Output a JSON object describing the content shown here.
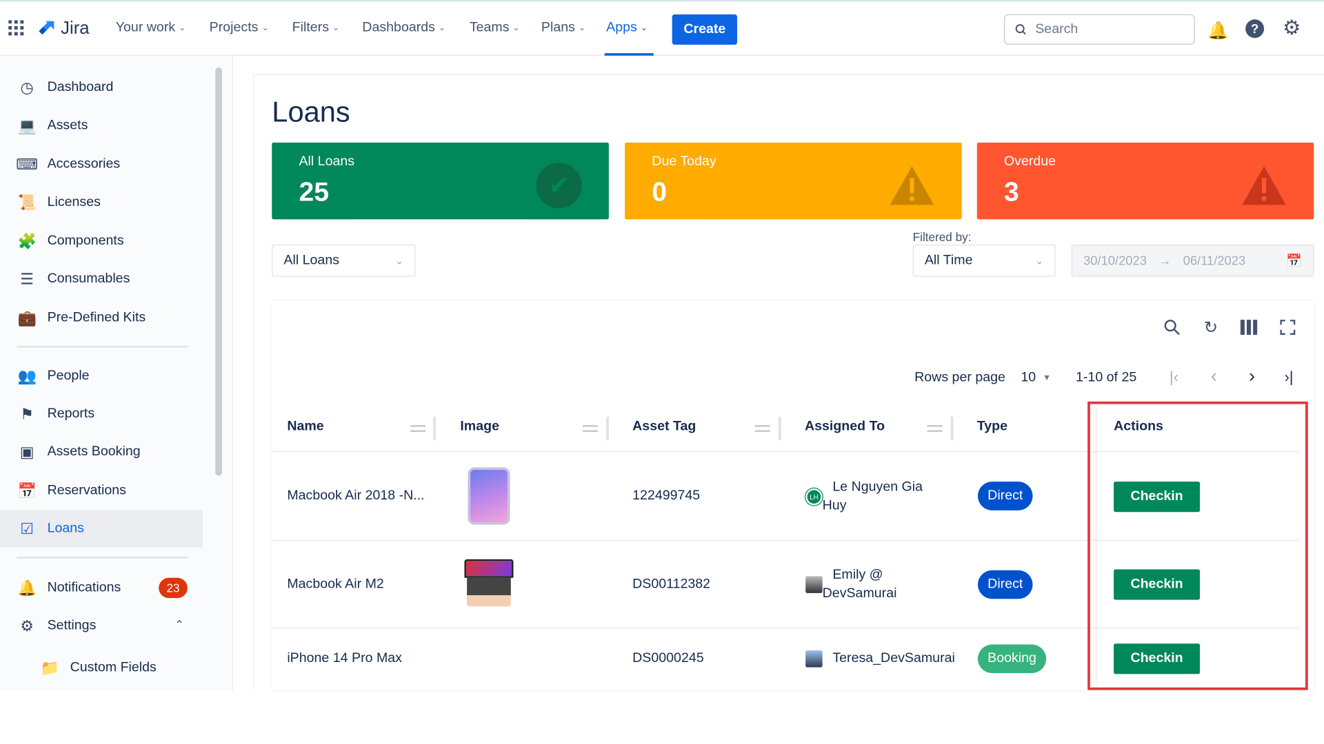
{
  "topnav": {
    "app_name": "Jira",
    "items": [
      {
        "label": "Your work"
      },
      {
        "label": "Projects"
      },
      {
        "label": "Filters"
      },
      {
        "label": "Dashboards"
      },
      {
        "label": "Teams"
      },
      {
        "label": "Plans"
      },
      {
        "label": "Apps",
        "active": true
      }
    ],
    "create_label": "Create",
    "search_placeholder": "Search"
  },
  "sidebar": {
    "items": [
      {
        "label": "Dashboard",
        "icon": "gauge-icon"
      },
      {
        "label": "Assets",
        "icon": "laptop-icon"
      },
      {
        "label": "Accessories",
        "icon": "keyboard-icon"
      },
      {
        "label": "Licenses",
        "icon": "scroll-icon"
      },
      {
        "label": "Components",
        "icon": "puzzle-icon"
      },
      {
        "label": "Consumables",
        "icon": "layers-icon"
      },
      {
        "label": "Pre-Defined Kits",
        "icon": "toolbox-icon"
      },
      {
        "label": "People",
        "icon": "people-icon"
      },
      {
        "label": "Reports",
        "icon": "flag-icon"
      },
      {
        "label": "Assets Booking",
        "icon": "booking-icon"
      },
      {
        "label": "Reservations",
        "icon": "calendar-icon"
      },
      {
        "label": "Loans",
        "icon": "calendar-check-icon",
        "active": true
      },
      {
        "label": "Notifications",
        "icon": "bell-icon",
        "badge": "23"
      },
      {
        "label": "Settings",
        "icon": "gear-icon"
      },
      {
        "label": "Custom Fields",
        "icon": "folder-icon"
      }
    ]
  },
  "page": {
    "title": "Loans",
    "cards": [
      {
        "label": "All Loans",
        "value": "25",
        "color": "#00875a",
        "icon": "check-circle-icon"
      },
      {
        "label": "Due Today",
        "value": "0",
        "color": "#ffab00",
        "icon": "warning-icon"
      },
      {
        "label": "Overdue",
        "value": "3",
        "color": "#ff5630",
        "icon": "warning-icon"
      }
    ],
    "loan_filter": "All Loans",
    "filtered_by_label": "Filtered by:",
    "time_filter": "All Time",
    "date_from": "30/10/2023",
    "date_to": "06/11/2023"
  },
  "table": {
    "rows_per_page_label": "Rows per page",
    "rows_per_page": "10",
    "range": "1-10 of 25",
    "columns": [
      "Name",
      "Image",
      "Asset Tag",
      "Assigned To",
      "Type",
      "Actions"
    ],
    "rows": [
      {
        "name": "Macbook Air 2018 -N...",
        "image": "iphone",
        "asset_tag": "122499745",
        "assigned_to": "Le Nguyen Gia Huy",
        "avatar_initials": "LH",
        "type": "Direct",
        "action": "Checkin"
      },
      {
        "name": "Macbook Air M2",
        "image": "macbook",
        "asset_tag": "DS00112382",
        "assigned_to": "Emily @ DevSamurai",
        "type": "Direct",
        "action": "Checkin"
      },
      {
        "name": "iPhone 14 Pro Max",
        "image": "",
        "asset_tag": "DS0000245",
        "assigned_to": "Teresa_DevSamurai",
        "type": "Booking",
        "action": "Checkin"
      }
    ],
    "type_colors": {
      "Direct": "#0052cc",
      "Booking": "#36b37e"
    }
  }
}
